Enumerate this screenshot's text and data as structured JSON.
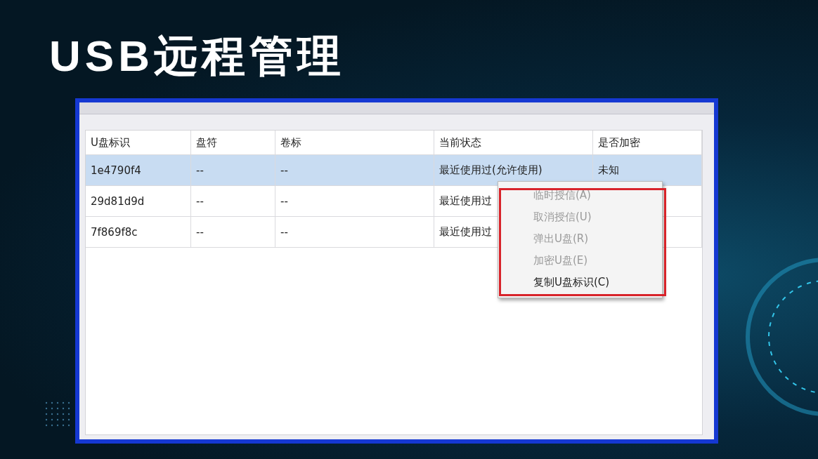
{
  "slide_title": "USB远程管理",
  "table": {
    "columns": [
      "U盘标识",
      "盘符",
      "卷标",
      "当前状态",
      "是否加密"
    ],
    "rows": [
      {
        "selected": true,
        "cells": [
          "1e4790f4",
          "--",
          "--",
          "最近使用过(允许使用)",
          "未知"
        ]
      },
      {
        "selected": false,
        "cells": [
          "29d81d9d",
          "--",
          "--",
          "最近使用过"
        ]
      },
      {
        "selected": false,
        "cells": [
          "7f869f8c",
          "--",
          "--",
          "最近使用过"
        ]
      }
    ]
  },
  "context_menu": {
    "items": [
      {
        "label": "临时授信(A)",
        "disabled": true
      },
      {
        "label": "取消授信(U)",
        "disabled": true
      },
      {
        "label": "弹出U盘(R)",
        "disabled": true
      },
      {
        "label": "加密U盘(E)",
        "disabled": true
      },
      {
        "label": "复制U盘标识(C)",
        "disabled": false
      }
    ]
  }
}
